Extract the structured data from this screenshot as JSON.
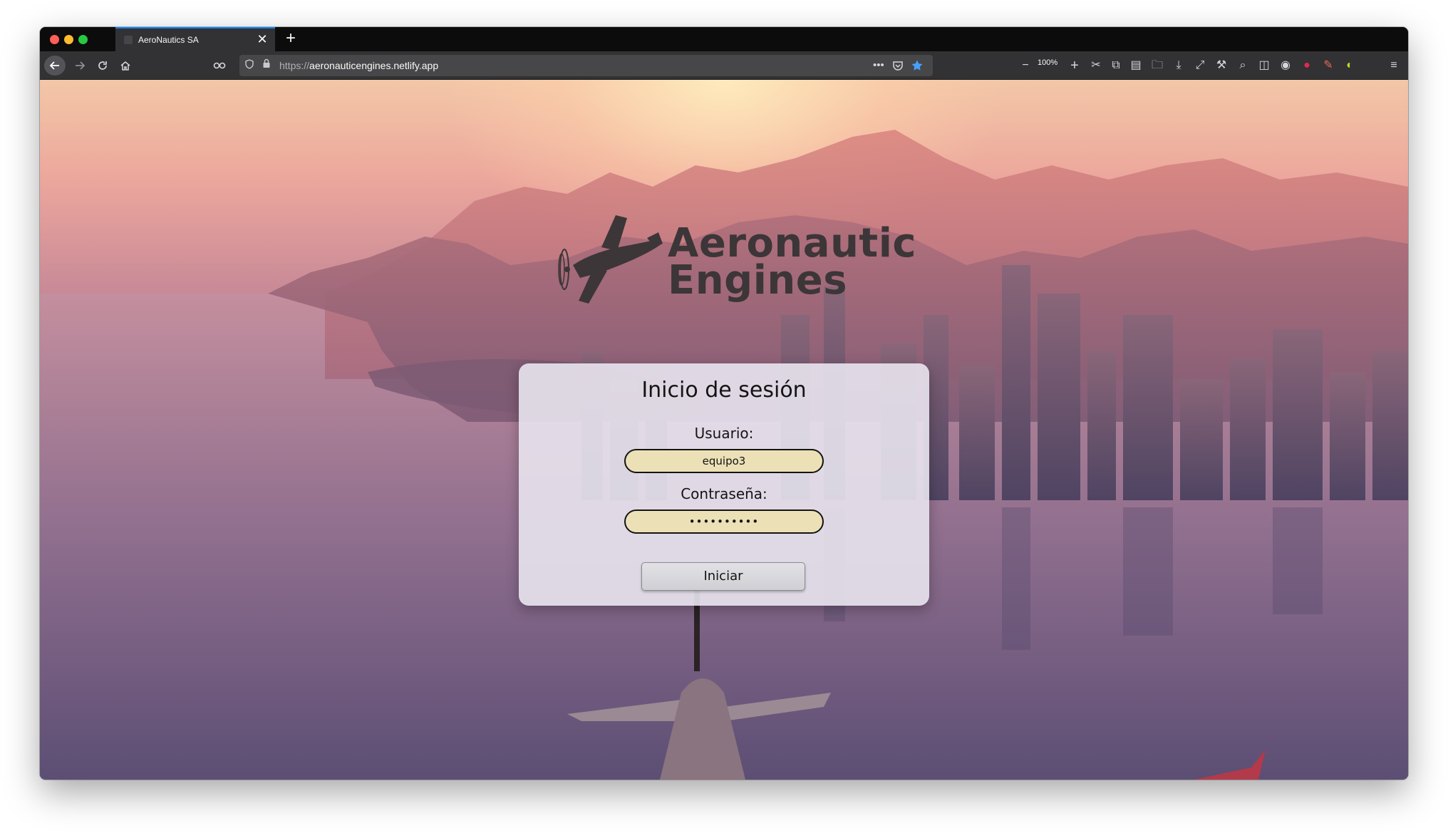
{
  "browser": {
    "tab_title": "AeroNautics SA",
    "tab_close": "✕",
    "new_tab": "+",
    "url_protocol": "https://",
    "url_host": "aeronauticengines.netlify.app",
    "zoom_level": "100%",
    "page_actions_icon": "more-dots",
    "accent_color": "#0a84ff"
  },
  "page": {
    "logo": {
      "line1": "Aeronautic",
      "line2": "Engines",
      "icon": "propeller-plane-icon"
    },
    "login": {
      "title": "Inicio de sesión",
      "username_label": "Usuario:",
      "username_value": "equipo3",
      "password_label": "Contraseña:",
      "password_masked": "••••••••••",
      "submit_label": "Iniciar",
      "field_color": "#ece0b6"
    }
  }
}
